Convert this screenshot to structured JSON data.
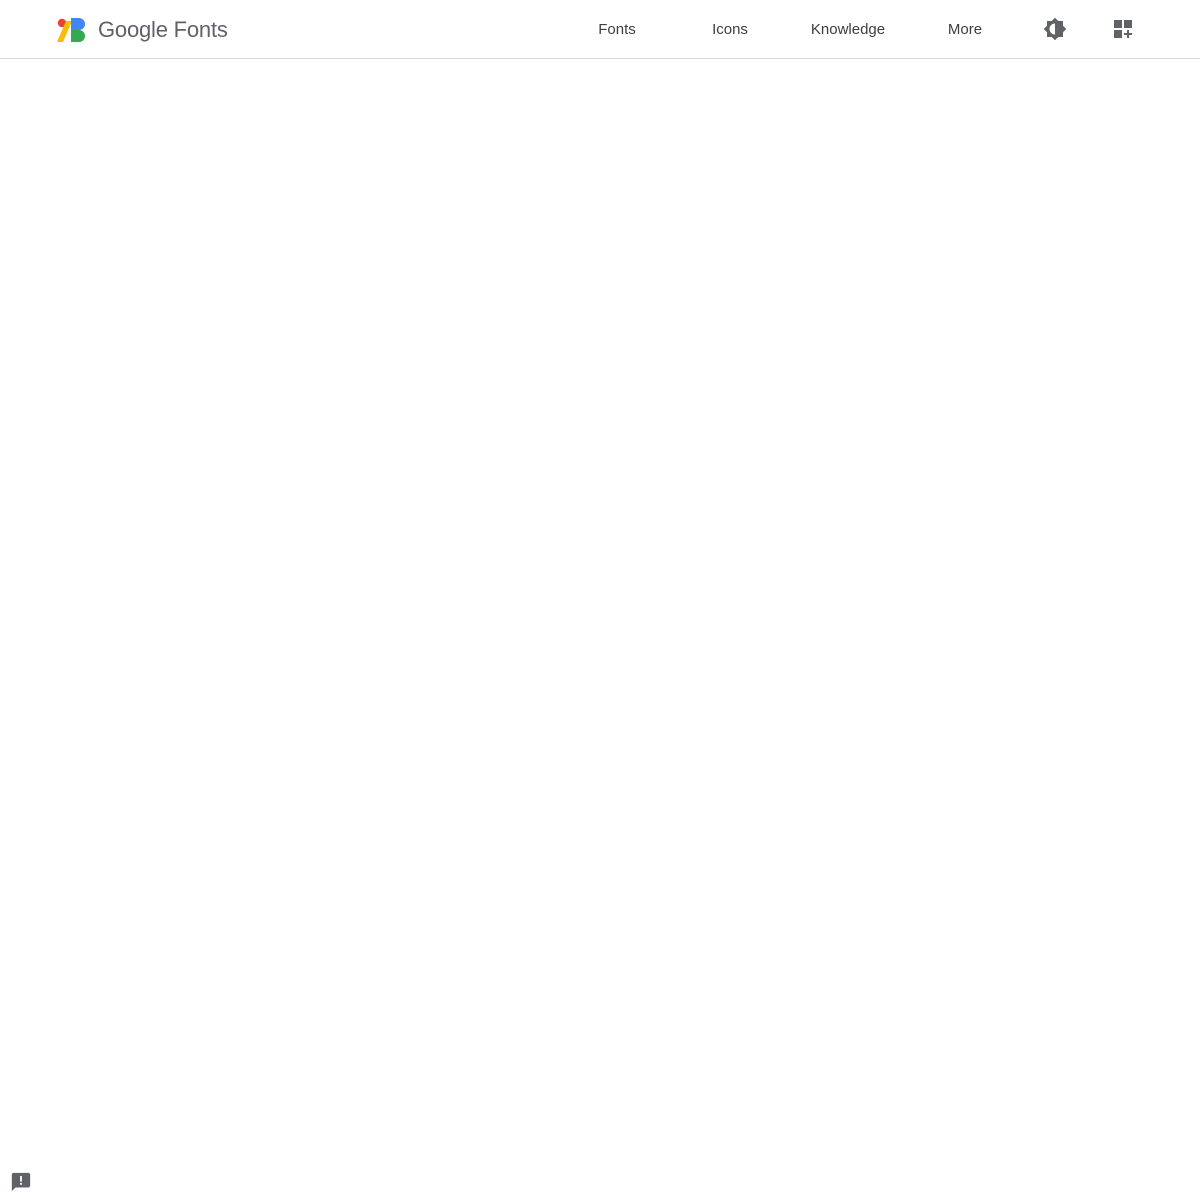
{
  "header": {
    "brand": {
      "name": "Google Fonts",
      "logo_icon": "google-fonts-logo-icon",
      "logo_colors": {
        "red": "#ea4335",
        "yellow": "#fbbc04",
        "blue": "#4285f4",
        "green": "#34a853"
      }
    },
    "nav": [
      {
        "label": "Fonts"
      },
      {
        "label": "Icons"
      },
      {
        "label": "Knowledge"
      },
      {
        "label": "More"
      }
    ],
    "actions": {
      "theme_icon": "brightness-icon",
      "collection_icon": "add-to-collection-icon"
    }
  },
  "footer": {
    "feedback_icon": "feedback-icon"
  },
  "colors": {
    "text": "#3c4043",
    "icon": "#5f6368",
    "divider": "#dadce0",
    "background": "#ffffff"
  }
}
